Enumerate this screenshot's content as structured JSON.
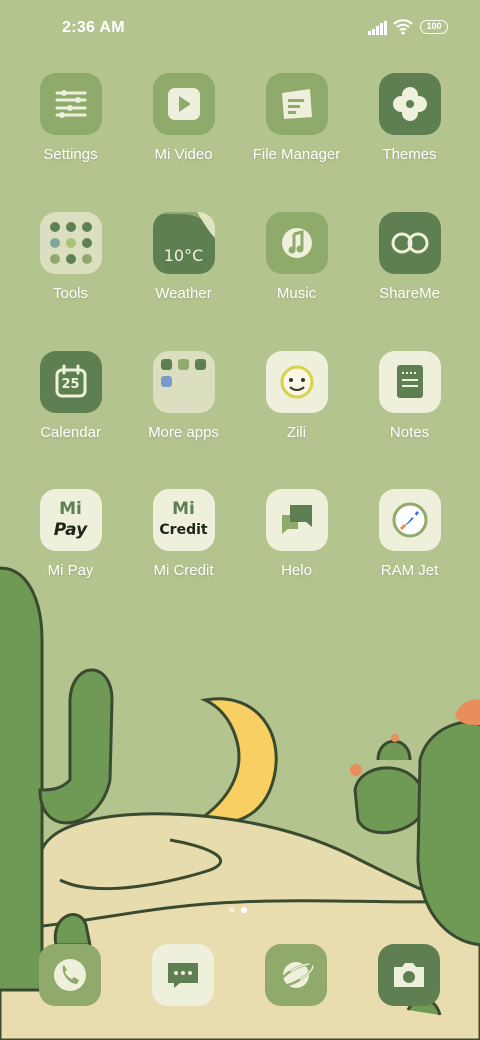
{
  "status_bar": {
    "time": "2:36 AM",
    "battery": "100"
  },
  "apps": [
    {
      "label": "Settings",
      "icon": "settings-icon"
    },
    {
      "label": "Mi Video",
      "icon": "play-icon"
    },
    {
      "label": "File Manager",
      "icon": "folder-icon"
    },
    {
      "label": "Themes",
      "icon": "flower-icon"
    },
    {
      "label": "Tools",
      "icon": "tools-folder-icon"
    },
    {
      "label": "Weather",
      "icon": "weather-icon",
      "temp": "10°C"
    },
    {
      "label": "Music",
      "icon": "music-note-icon"
    },
    {
      "label": "ShareMe",
      "icon": "infinity-icon"
    },
    {
      "label": "Calendar",
      "icon": "calendar-icon",
      "day": "25"
    },
    {
      "label": "More apps",
      "icon": "more-apps-folder-icon"
    },
    {
      "label": "Zili",
      "icon": "zili-face-icon"
    },
    {
      "label": "Notes",
      "icon": "notes-icon"
    },
    {
      "label": "Mi Pay",
      "icon": "mi-pay-icon",
      "glyph_top": "Mi",
      "glyph_bottom": "Pay"
    },
    {
      "label": "Mi Credit",
      "icon": "mi-credit-icon",
      "glyph_top": "Mi",
      "glyph_bottom": "Credit"
    },
    {
      "label": "Helo",
      "icon": "chat-bubbles-icon"
    },
    {
      "label": "RAM Jet",
      "icon": "rocket-icon"
    }
  ],
  "dock": [
    {
      "icon": "phone-icon"
    },
    {
      "icon": "messages-icon"
    },
    {
      "icon": "browser-planet-icon"
    },
    {
      "icon": "camera-icon"
    }
  ],
  "pager": {
    "pages": 2,
    "active": 2
  },
  "colors": {
    "background": "#b3c48f",
    "dark_green": "#5e7f52",
    "mid_green": "#8faa6a",
    "cream": "#e8e8cf",
    "sand": "#e6dcae",
    "moon": "#f8cf62"
  }
}
